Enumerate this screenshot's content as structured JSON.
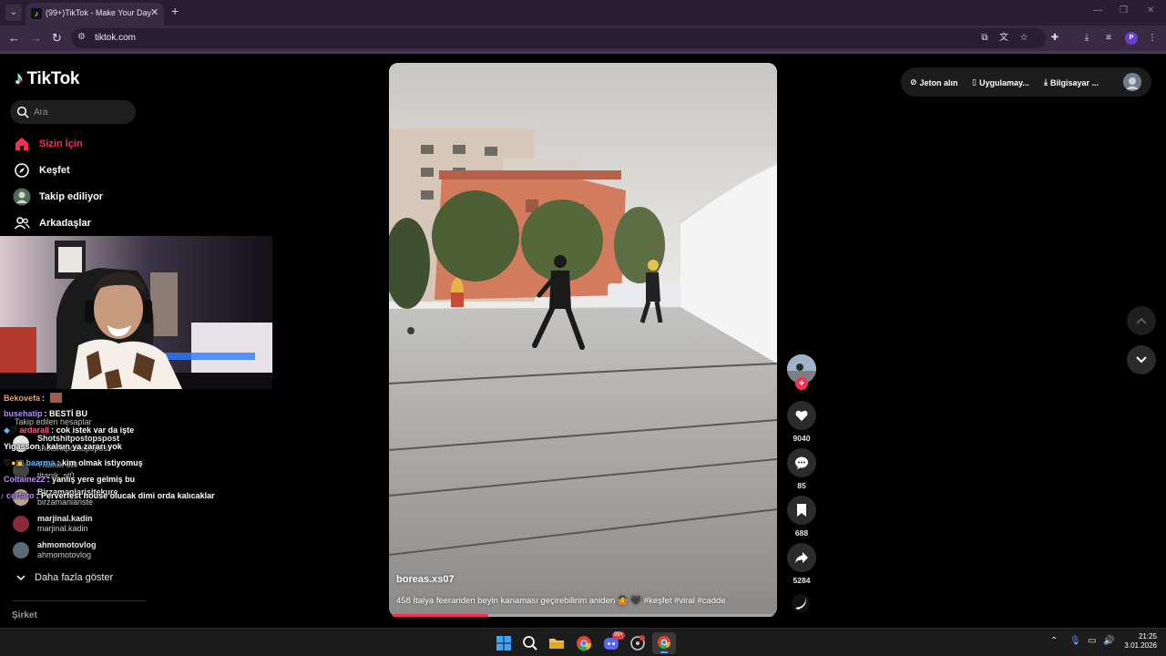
{
  "browser": {
    "tab_title": "(99+)TikTok - Make Your Day",
    "url": "tiktok.com"
  },
  "sidebar": {
    "logo_text": "TikTok",
    "search_placeholder": "Ara",
    "nav": [
      {
        "label": "Sizin İçin",
        "icon": "home-icon",
        "active": true
      },
      {
        "label": "Keşfet",
        "icon": "compass-icon"
      },
      {
        "label": "Takip ediliyor",
        "icon": "avatar"
      },
      {
        "label": "Arkadaşlar",
        "icon": "friends-icon"
      }
    ],
    "following_title": "Takip edilen hesaplar",
    "following": [
      {
        "name": "Shotshitpostopspost",
        "handle": "shotshitpostopspost"
      },
      {
        "name": "Yigasson",
        "handle": "titanik_st0"
      },
      {
        "name": "Titanik st0",
        "handle": "titanik_st0"
      },
      {
        "name": "Birzamanlarisitekure",
        "handle": "birzamanlariste"
      },
      {
        "name": "marjinal.kadin",
        "handle": "marjinal.kadin"
      },
      {
        "name": "ahmomotovlog",
        "handle": "ahmomotovlog"
      }
    ],
    "show_more": "Daha fazla göster",
    "company": "Şirket"
  },
  "chat": [
    {
      "user": "Bekovefa",
      "sep": ":",
      "msg": "",
      "color": "#f0a04b"
    },
    {
      "user": "busehatip",
      "sep": ":",
      "msg": "BESTİ BU",
      "color": "#b38cf5"
    },
    {
      "user": "ardarall",
      "sep": ":",
      "msg": "cok istek var da işte",
      "color": "#ff5c8a"
    },
    {
      "user": "Yigasson",
      "sep": ":",
      "msg": "kalsın ya zararı yok",
      "color": "#ffffff"
    },
    {
      "user": "baarma",
      "sep": ":",
      "msg": "kim olmak istiyomuş",
      "color": "#5fb7ff"
    },
    {
      "user": "Coltaine22",
      "sep": ":",
      "msg": "yanlış yere gelmiş bu",
      "color": "#c38cff"
    },
    {
      "user": "cerfaro",
      "sep": ":",
      "msg": "Perverfest house olucak dimi orda kalıcaklar",
      "color": "#c38cff"
    }
  ],
  "video": {
    "author": "boreas.xs07",
    "caption": "458 İtalya feerariden beyin kanaması geçirebilirim aniden 🤷 🖤 #keşfet #viral #cadde",
    "progress": 0.25,
    "counts": {
      "likes": "9040",
      "comments": "85",
      "saves": "688",
      "shares": "5284"
    }
  },
  "header": {
    "coins": "Jeton alın",
    "app": "Uygulamay...",
    "desktop": "Bilgisayar ..."
  },
  "taskbar": {
    "time": "21:25",
    "date": "3.01.2026",
    "discord_badge": "99+"
  },
  "colors": {
    "accent": "#fe2c55",
    "browser_frame": "#3a2b45",
    "background": "#000000"
  }
}
